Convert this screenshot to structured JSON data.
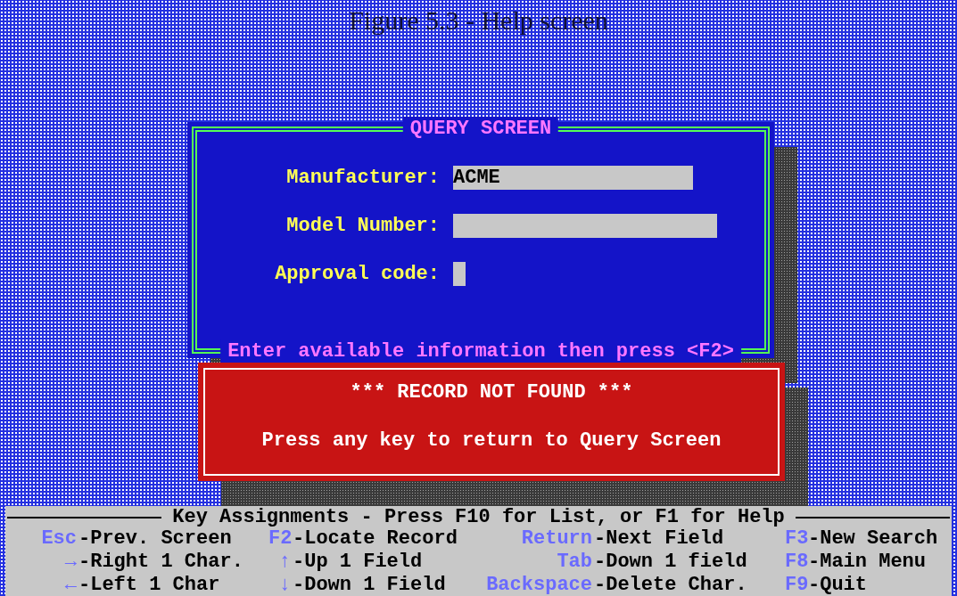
{
  "caption": "Figure 5.3 - Help screen",
  "query_window": {
    "title": "QUERY SCREEN",
    "fields": [
      {
        "label": "Manufacturer:",
        "value": "ACME"
      },
      {
        "label": "Model Number:"
      },
      {
        "label": "Approval code:"
      }
    ],
    "hint": "Enter available information then press <F2>"
  },
  "alert": {
    "title": "*** RECORD NOT FOUND ***",
    "message": "Press any key to return to Query Screen"
  },
  "key_bar": {
    "title": "Key Assignments - Press F10 for List, or F1 for Help",
    "rows": [
      [
        {
          "key": "Esc",
          "action": "-Prev. Screen"
        },
        {
          "key": "F2",
          "action": "-Locate Record"
        },
        {
          "key": "Return",
          "action": "-Next Field"
        },
        {
          "key": "F3",
          "action": "-New Search"
        }
      ],
      [
        {
          "key": "→",
          "action": "-Right 1 Char."
        },
        {
          "key": "↑",
          "action": "-Up 1 Field"
        },
        {
          "key": "Tab",
          "action": "-Down 1 field"
        },
        {
          "key": "F8",
          "action": "-Main Menu"
        }
      ],
      [
        {
          "key": "←",
          "action": "-Left 1 Char"
        },
        {
          "key": "↓",
          "action": "-Down 1 Field"
        },
        {
          "key": "Backspace",
          "action": "-Delete Char."
        },
        {
          "key": "F9",
          "action": "-Quit"
        }
      ]
    ]
  }
}
